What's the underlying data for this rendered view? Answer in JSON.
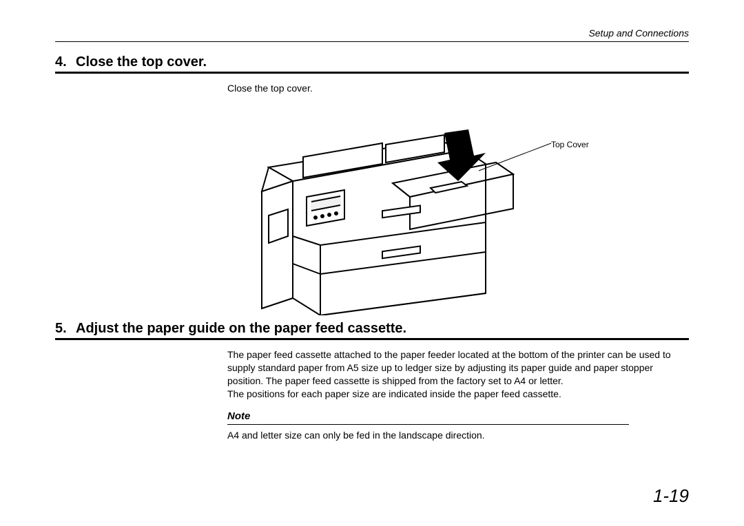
{
  "header": {
    "section_title": "Setup and Connections"
  },
  "step4": {
    "number": "4.",
    "title": "Close the top cover.",
    "body": "Close the top cover.",
    "figure_label": "Top Cover"
  },
  "step5": {
    "number": "5.",
    "title": "Adjust the paper guide on the paper feed cassette.",
    "body1": "The paper feed cassette attached to the paper feeder located at the bottom of the printer can be used   to supply standard paper from A5 size up to ledger size by adjusting its paper guide and paper stopper position.  The paper feed cassette is shipped from the factory set to A4 or letter.",
    "body2": "The positions for each paper size are indicated inside the paper feed cassette.",
    "note_heading": "Note",
    "note_body": "A4 and letter size can only be fed in the landscape direction."
  },
  "page_number": "1-19"
}
